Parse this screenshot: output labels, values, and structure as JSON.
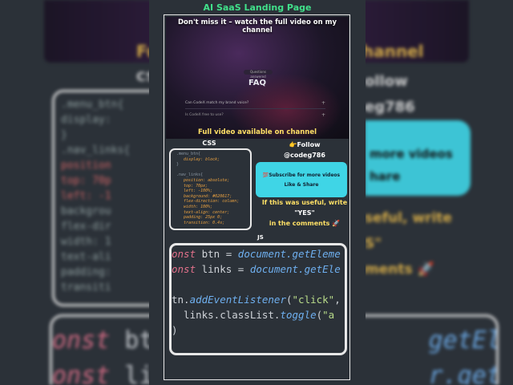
{
  "title": "AI SaaS Landing Page",
  "video": {
    "banner": "Don't miss it – watch the full video on my channel",
    "pill": "Questions answered",
    "heading": "FAQ",
    "question_1": "Can CodeX match my brand voice?",
    "question_2": "Is CodeX free to use?",
    "caption": "Full video available on channel"
  },
  "css": {
    "label": "CSS",
    "lines": [
      " .menu_btn{",
      "    display: block;",
      " }",
      "",
      " .nav_links{",
      "    position: absolute;",
      "    top: 70px;",
      "    left: -100%;",
      "    background: #020617;",
      "    flex-direction: column;",
      "    width: 100%;",
      "    text-align: center;",
      "    padding: 25px 0;",
      "    transition: 0.4s;"
    ]
  },
  "follow": {
    "line1": "👉Follow",
    "handle": "@codeg786"
  },
  "subscribe": {
    "line1": "💯Subscribe for more videos",
    "line2": "Like & Share"
  },
  "useful": {
    "line1": "If this was useful, write",
    "line2": "\"YES\"",
    "line3": "in the comments 🚀"
  },
  "js": {
    "label": "JS",
    "kw1": "onst",
    "var1": " btn = ",
    "call1": "document.getEleme",
    "kw2": "onst",
    "var2": " links = ",
    "call2": "document.getEle",
    "line3a": "tn.",
    "line3fn": "addEventListener",
    "line3b": "(",
    "line3str": "\"click\"",
    "line3c": ",",
    "line4a": "  links.classList.",
    "line4fn": "toggle",
    "line4b": "(",
    "line4str": "\"a",
    "line5": ")"
  },
  "background": {
    "title_left": "Full",
    "title_right": "channel",
    "css_label": "CSS",
    "code_lines": [
      ".menu_btn{",
      "   display:",
      "}",
      "",
      ".nav_links{",
      "   position",
      "   top: 70p",
      "   left: -1",
      "   backgrou",
      "   flex-dir",
      "   width: 1",
      "   text-ali",
      "   padding:",
      "   transiti"
    ],
    "follow_line1": "ollow",
    "follow_line2": "eg786",
    "sub_line1": "more videos",
    "sub_line2": "hare",
    "useful_line1": "seful, write",
    "useful_line2": "S\"",
    "useful_line3": "ments 🚀",
    "js_line1_kw": "onst",
    "js_line1": " bt",
    "js_line1_right": "getEleme",
    "js_line2_kw": "onst",
    "js_line2": " li",
    "js_line2_right": "r.getEle"
  }
}
